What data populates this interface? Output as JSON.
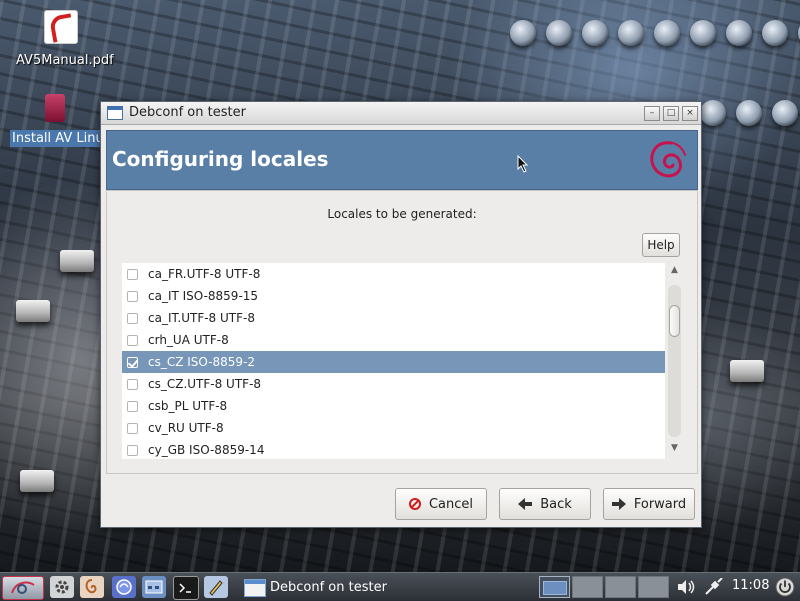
{
  "desktop": {
    "icons": [
      {
        "label": "AV5Manual.pdf",
        "icon": "pdf-document-icon"
      },
      {
        "label": "Install AV Linux",
        "icon": "installer-icon"
      }
    ]
  },
  "window": {
    "title": "Debconf on tester",
    "controls": {
      "minimize": "–",
      "maximize": "□",
      "close": "×"
    },
    "header": {
      "title": "Configuring locales",
      "logo": "debian-swirl-icon"
    },
    "prompt": "Locales to be generated:",
    "help_label": "Help",
    "locales": [
      {
        "label": "ca_FR.UTF-8 UTF-8",
        "checked": false
      },
      {
        "label": "ca_IT ISO-8859-15",
        "checked": false
      },
      {
        "label": "ca_IT.UTF-8 UTF-8",
        "checked": false
      },
      {
        "label": "crh_UA UTF-8",
        "checked": false
      },
      {
        "label": "cs_CZ ISO-8859-2",
        "checked": true
      },
      {
        "label": "cs_CZ.UTF-8 UTF-8",
        "checked": false
      },
      {
        "label": "csb_PL UTF-8",
        "checked": false
      },
      {
        "label": "cv_RU UTF-8",
        "checked": false
      },
      {
        "label": "cy_GB ISO-8859-14",
        "checked": false
      }
    ],
    "buttons": {
      "cancel": "Cancel",
      "back": "Back",
      "forward": "Forward"
    }
  },
  "taskbar": {
    "task_label": "Debconf on tester",
    "clock": "11:08",
    "launchers": [
      "menu-icon",
      "settings-icon",
      "shell-icon",
      "browser-icon",
      "file-manager-icon",
      "terminal-icon",
      "text-editor-icon"
    ],
    "tray": [
      "volume-icon",
      "network-icon",
      "power-icon"
    ]
  },
  "colors": {
    "header": "#5a7fa6",
    "selection": "#7796b8",
    "cancel_red": "#d21c1c"
  }
}
